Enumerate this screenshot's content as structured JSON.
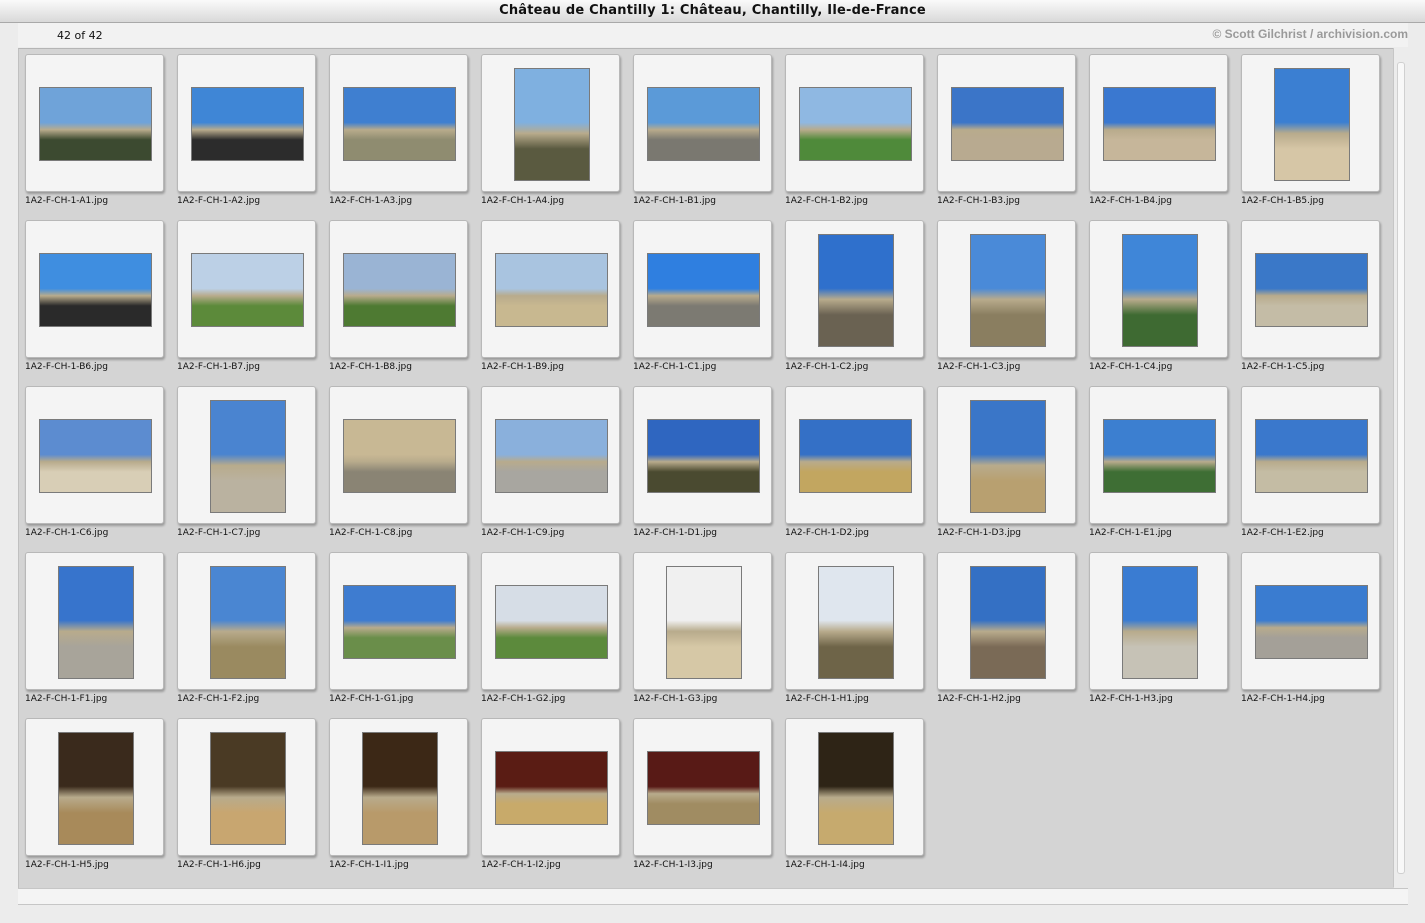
{
  "window": {
    "title": "Château de Chantilly 1: Château, Chantilly, Ile-de-France"
  },
  "header": {
    "count": "42 of 42",
    "credit": "© Scott Gilchrist / archivision.com"
  },
  "thumbnails": [
    {
      "filename": "1A2-F-CH-1-A1.jpg",
      "orientation": "landscape",
      "sky": "#6fa3d9",
      "ground": "#3c4a30"
    },
    {
      "filename": "1A2-F-CH-1-A2.jpg",
      "orientation": "landscape",
      "sky": "#3f86d6",
      "ground": "#2c2c2c"
    },
    {
      "filename": "1A2-F-CH-1-A3.jpg",
      "orientation": "landscape",
      "sky": "#3f7fd0",
      "ground": "#8f8c70"
    },
    {
      "filename": "1A2-F-CH-1-A4.jpg",
      "orientation": "portrait",
      "sky": "#7fb0e0",
      "ground": "#5a5a40"
    },
    {
      "filename": "1A2-F-CH-1-B1.jpg",
      "orientation": "landscape",
      "sky": "#5b9ad8",
      "ground": "#7a7870"
    },
    {
      "filename": "1A2-F-CH-1-B2.jpg",
      "orientation": "landscape",
      "sky": "#8fb8e2",
      "ground": "#4f8a3a"
    },
    {
      "filename": "1A2-F-CH-1-B3.jpg",
      "orientation": "landscape",
      "sky": "#3b75c8",
      "ground": "#b8aa90"
    },
    {
      "filename": "1A2-F-CH-1-B4.jpg",
      "orientation": "landscape",
      "sky": "#3a78d0",
      "ground": "#c6b69a"
    },
    {
      "filename": "1A2-F-CH-1-B5.jpg",
      "orientation": "portrait",
      "sky": "#3b7fd2",
      "ground": "#d6c6a6"
    },
    {
      "filename": "1A2-F-CH-1-B6.jpg",
      "orientation": "landscape",
      "sky": "#3f8ee0",
      "ground": "#2a2a2a"
    },
    {
      "filename": "1A2-F-CH-1-B7.jpg",
      "orientation": "landscape",
      "sky": "#bcd0e6",
      "ground": "#5c8a3a"
    },
    {
      "filename": "1A2-F-CH-1-B8.jpg",
      "orientation": "landscape",
      "sky": "#9ab4d4",
      "ground": "#4e7a32"
    },
    {
      "filename": "1A2-F-CH-1-B9.jpg",
      "orientation": "landscape",
      "sky": "#a9c4e0",
      "ground": "#c8b890"
    },
    {
      "filename": "1A2-F-CH-1-C1.jpg",
      "orientation": "landscape",
      "sky": "#2f7fe0",
      "ground": "#7c7a72"
    },
    {
      "filename": "1A2-F-CH-1-C2.jpg",
      "orientation": "portrait",
      "sky": "#2f70cc",
      "ground": "#6a6252"
    },
    {
      "filename": "1A2-F-CH-1-C3.jpg",
      "orientation": "portrait",
      "sky": "#4a8ad8",
      "ground": "#8a7e60"
    },
    {
      "filename": "1A2-F-CH-1-C4.jpg",
      "orientation": "portrait",
      "sky": "#3f86d8",
      "ground": "#3e6a32"
    },
    {
      "filename": "1A2-F-CH-1-C5.jpg",
      "orientation": "landscape",
      "sky": "#3a78c8",
      "ground": "#c4bca6"
    },
    {
      "filename": "1A2-F-CH-1-C6.jpg",
      "orientation": "landscape",
      "sky": "#5c8cd0",
      "ground": "#d8ceb6"
    },
    {
      "filename": "1A2-F-CH-1-C7.jpg",
      "orientation": "portrait",
      "sky": "#4a84d0",
      "ground": "#bab2a0"
    },
    {
      "filename": "1A2-F-CH-1-C8.jpg",
      "orientation": "landscape",
      "sky": "#c8b894",
      "ground": "#8a8474"
    },
    {
      "filename": "1A2-F-CH-1-C9.jpg",
      "orientation": "landscape",
      "sky": "#8ab0dc",
      "ground": "#a8a6a0"
    },
    {
      "filename": "1A2-F-CH-1-D1.jpg",
      "orientation": "landscape",
      "sky": "#2f66c0",
      "ground": "#4a4a30"
    },
    {
      "filename": "1A2-F-CH-1-D2.jpg",
      "orientation": "landscape",
      "sky": "#3470c6",
      "ground": "#c2a660"
    },
    {
      "filename": "1A2-F-CH-1-D3.jpg",
      "orientation": "portrait",
      "sky": "#3a76c8",
      "ground": "#b8a070"
    },
    {
      "filename": "1A2-F-CH-1-E1.jpg",
      "orientation": "landscape",
      "sky": "#3c7fd0",
      "ground": "#3e6e34"
    },
    {
      "filename": "1A2-F-CH-1-E2.jpg",
      "orientation": "landscape",
      "sky": "#3a78cc",
      "ground": "#c4bca4"
    },
    {
      "filename": "1A2-F-CH-1-F1.jpg",
      "orientation": "portrait",
      "sky": "#3774cc",
      "ground": "#a8a49a"
    },
    {
      "filename": "1A2-F-CH-1-F2.jpg",
      "orientation": "portrait",
      "sky": "#4a86d2",
      "ground": "#9a8a60"
    },
    {
      "filename": "1A2-F-CH-1-G1.jpg",
      "orientation": "landscape",
      "sky": "#3e7cd0",
      "ground": "#6a8e4a"
    },
    {
      "filename": "1A2-F-CH-1-G2.jpg",
      "orientation": "landscape",
      "sky": "#d6dde6",
      "ground": "#5c8a3c"
    },
    {
      "filename": "1A2-F-CH-1-G3.jpg",
      "orientation": "portrait",
      "sky": "#f0f0f0",
      "ground": "#d6c8a6"
    },
    {
      "filename": "1A2-F-CH-1-H1.jpg",
      "orientation": "portrait",
      "sky": "#dfe6ee",
      "ground": "#6e6448"
    },
    {
      "filename": "1A2-F-CH-1-H2.jpg",
      "orientation": "portrait",
      "sky": "#3470c4",
      "ground": "#7a6a56"
    },
    {
      "filename": "1A2-F-CH-1-H3.jpg",
      "orientation": "portrait",
      "sky": "#3a7cd2",
      "ground": "#c6c2b6"
    },
    {
      "filename": "1A2-F-CH-1-H4.jpg",
      "orientation": "landscape",
      "sky": "#3a7cd0",
      "ground": "#a4a098"
    },
    {
      "filename": "1A2-F-CH-1-H5.jpg",
      "orientation": "portrait",
      "sky": "#3a2a1c",
      "ground": "#a88a5a"
    },
    {
      "filename": "1A2-F-CH-1-H6.jpg",
      "orientation": "portrait",
      "sky": "#4a3a24",
      "ground": "#c8a670"
    },
    {
      "filename": "1A2-F-CH-1-I1.jpg",
      "orientation": "portrait",
      "sky": "#3c2816",
      "ground": "#b89a6a"
    },
    {
      "filename": "1A2-F-CH-1-I2.jpg",
      "orientation": "landscape",
      "sky": "#5a1c14",
      "ground": "#c8aa6a"
    },
    {
      "filename": "1A2-F-CH-1-I3.jpg",
      "orientation": "landscape",
      "sky": "#581a16",
      "ground": "#a08c62"
    },
    {
      "filename": "1A2-F-CH-1-I4.jpg",
      "orientation": "portrait",
      "sky": "#2e2416",
      "ground": "#c6aa6e"
    }
  ]
}
